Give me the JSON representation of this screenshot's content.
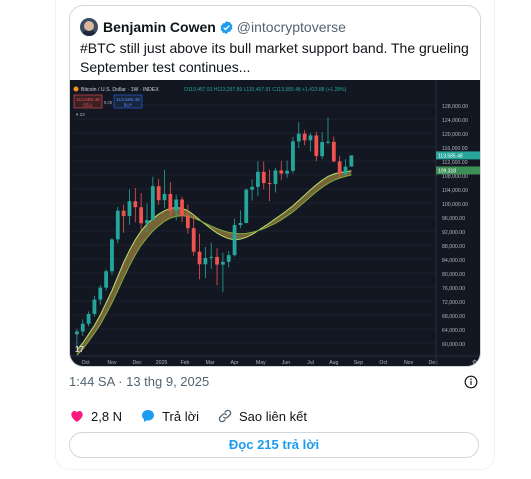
{
  "quoted_tweet": {
    "author_name": "Benjamin Cowen",
    "author_handle": "@intocryptoverse",
    "verified": true,
    "text_line1": "#BTC still just above its bull market support band. The grueling",
    "text_line2": "September test continues...",
    "chart_image": {
      "header_text": "Bitcoin / U.S. Dollar · 1W · INDEX",
      "ohlc_text": "O110,457.91 H113,297.89 L110,457.91 C113,585.48 +1,423.88 (+1.28%)",
      "sell_price": "113,585.48",
      "sell_label": "SELL",
      "buy_price": "113,585.48",
      "buy_label": "BUY",
      "spread": "0.00",
      "indicator_count": "23",
      "price_tag_1": "113,585.48",
      "price_tag_2": "109,318",
      "x_labels": [
        "Oct",
        "Nov",
        "Dec",
        "2025",
        "Feb",
        "Mar",
        "Apr",
        "May",
        "Jun",
        "Jul",
        "Aug",
        "Sep",
        "Oct",
        "Nov",
        "Dec"
      ],
      "y_labels": [
        "128,000.00",
        "124,000.00",
        "120,000.00",
        "116,000.00",
        "112,000.00",
        "108,000.00",
        "104,000.00",
        "100,000.00",
        "96,000.00",
        "92,000.00",
        "88,000.00",
        "84,000.00",
        "80,000.00",
        "76,000.00",
        "72,000.00",
        "68,000.00",
        "64,000.00",
        "60,000.00"
      ],
      "candles": [
        [
          62500,
          64000,
          58900,
          63300
        ],
        [
          63300,
          66800,
          62000,
          65500
        ],
        [
          65500,
          69000,
          64800,
          68300
        ],
        [
          68300,
          73500,
          67500,
          72400
        ],
        [
          72400,
          76500,
          71000,
          75800
        ],
        [
          75800,
          81000,
          75000,
          80500
        ],
        [
          80500,
          89900,
          79500,
          89600
        ],
        [
          89600,
          98900,
          88500,
          97800
        ],
        [
          97800,
          99500,
          91500,
          96300
        ],
        [
          96300,
          103900,
          93800,
          100500
        ],
        [
          100500,
          104300,
          94500,
          98800
        ],
        [
          98800,
          102800,
          92300,
          94200
        ],
        [
          94200,
          99900,
          91500,
          95100
        ],
        [
          95100,
          107500,
          94800,
          104800
        ],
        [
          104800,
          106900,
          99500,
          100800
        ],
        [
          100800,
          109500,
          98500,
          102600
        ],
        [
          102600,
          106000,
          96200,
          97800
        ],
        [
          97800,
          102400,
          95000,
          101000
        ],
        [
          101000,
          101800,
          94500,
          96300
        ],
        [
          96300,
          99500,
          91200,
          92800
        ],
        [
          92800,
          96600,
          84900,
          86100
        ],
        [
          86100,
          91200,
          78200,
          82500
        ],
        [
          82500,
          87500,
          78500,
          84300
        ],
        [
          84300,
          88700,
          81200,
          84600
        ],
        [
          84600,
          87100,
          76500,
          82400
        ],
        [
          82400,
          85800,
          74500,
          83200
        ],
        [
          83200,
          86200,
          81600,
          85100
        ],
        [
          85100,
          95500,
          84700,
          93700
        ],
        [
          93700,
          97900,
          92800,
          94300
        ],
        [
          94300,
          104200,
          94200,
          103800
        ],
        [
          103800,
          106800,
          100700,
          104600
        ],
        [
          104600,
          111900,
          102000,
          108900
        ],
        [
          108900,
          111800,
          103900,
          105700
        ],
        [
          105700,
          109500,
          100500,
          105400
        ],
        [
          105400,
          110000,
          103000,
          109300
        ],
        [
          109300,
          112000,
          106500,
          108400
        ],
        [
          108400,
          112100,
          107200,
          109200
        ],
        [
          109200,
          118900,
          108400,
          117600
        ],
        [
          117600,
          123100,
          115700,
          119800
        ],
        [
          119800,
          120800,
          116500,
          117900
        ],
        [
          117900,
          120000,
          114700,
          119300
        ],
        [
          119300,
          120300,
          112000,
          113400
        ],
        [
          113400,
          120200,
          112600,
          117400
        ],
        [
          117400,
          124400,
          116700,
          117500
        ],
        [
          117500,
          119000,
          111600,
          111900
        ],
        [
          111900,
          113400,
          107300,
          108300
        ],
        [
          108300,
          112500,
          107800,
          110400
        ],
        [
          110400,
          113400,
          110400,
          113600
        ]
      ],
      "support_band_upper": [
        58000,
        60000,
        62500,
        65000,
        68000,
        71500,
        75000,
        79000,
        83000,
        86500,
        89500,
        92000,
        94000,
        95500,
        96800,
        97800,
        98500,
        98700,
        98500,
        97800,
        96600,
        95200,
        93900,
        92600,
        91400,
        90500,
        89800,
        89500,
        89700,
        90200,
        91000,
        92100,
        93200,
        94300,
        95500,
        96700,
        97900,
        99200,
        100700,
        102200,
        103800,
        105200,
        106500,
        107600,
        108300,
        108700,
        108900,
        109200
      ],
      "support_band_lower": [
        56500,
        58300,
        60500,
        62800,
        65300,
        68300,
        71500,
        75000,
        78600,
        82100,
        85200,
        87900,
        90100,
        92000,
        93500,
        94800,
        95700,
        96200,
        96400,
        96200,
        95700,
        95000,
        94200,
        93400,
        92700,
        92100,
        91600,
        91300,
        91200,
        91300,
        91600,
        92100,
        92700,
        93400,
        94200,
        95200,
        96300,
        97500,
        98900,
        100300,
        101800,
        103200,
        104500,
        105600,
        106500,
        107100,
        107600,
        108000
      ]
    }
  },
  "timestamp": "1:44 SA · 13 thg 9, 2025",
  "actions": {
    "likes": "2,8 N",
    "reply_label": "Trả lời",
    "copy_link_label": "Sao liên kết"
  },
  "read_replies_label": "Đọc 215 trả lời",
  "colors": {
    "accent": "#1d9bf0",
    "like": "#f91880",
    "chart_bg": "#131722",
    "candle_up": "#26a69a",
    "candle_down": "#ef5350"
  }
}
